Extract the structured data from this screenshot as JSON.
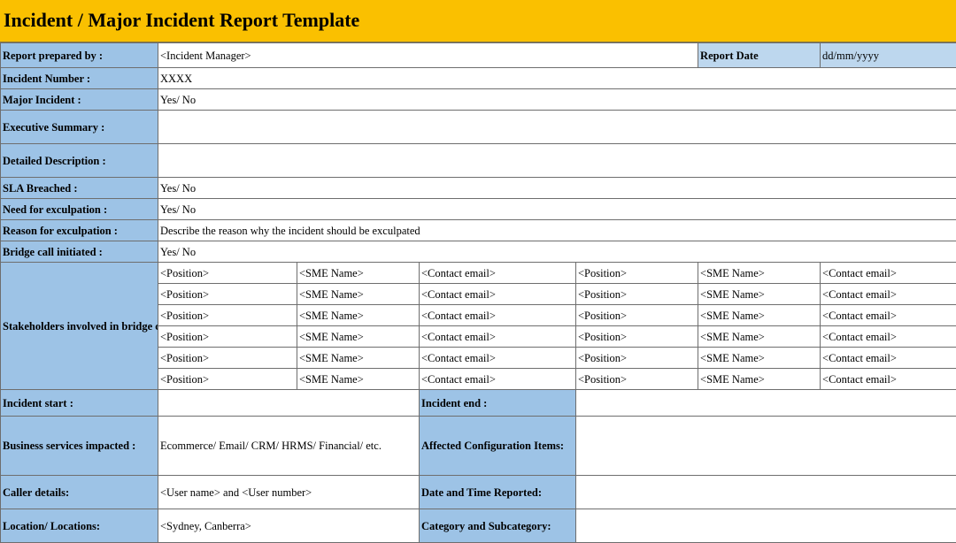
{
  "title": "Incident / Major Incident Report Template",
  "report": {
    "prepared_by_label": "Report prepared by :",
    "prepared_by_value": "<Incident Manager>",
    "date_label": "Report Date",
    "date_value": "dd/mm/yyyy"
  },
  "rows": {
    "incident_number": {
      "label": "Incident Number :",
      "value": "XXXX"
    },
    "major_incident": {
      "label": "Major Incident :",
      "value": "Yes/ No"
    },
    "executive_summary": {
      "label": "Executive Summary :",
      "value": ""
    },
    "detailed_description": {
      "label": "Detailed Description :",
      "value": ""
    },
    "sla_breached": {
      "label": "SLA Breached :",
      "value": "Yes/ No"
    },
    "need_exculpation": {
      "label": "Need for exculpation :",
      "value": "Yes/ No"
    },
    "reason_exculpation": {
      "label": "Reason for exculpation :",
      "value": "Describe the reason why the incident should be exculpated"
    },
    "bridge_call": {
      "label": "Bridge call initiated :",
      "value": "Yes/ No"
    }
  },
  "stakeholders": {
    "label": "Stakeholders involved in bridge call :",
    "rows": [
      [
        "<Position>",
        "<SME Name>",
        "<Contact email>",
        "<Position>",
        "<SME Name>",
        "<Contact email>"
      ],
      [
        "<Position>",
        "<SME Name>",
        "<Contact email>",
        "<Position>",
        "<SME Name>",
        "<Contact email>"
      ],
      [
        "<Position>",
        "<SME Name>",
        "<Contact email>",
        "<Position>",
        "<SME Name>",
        "<Contact email>"
      ],
      [
        "<Position>",
        "<SME Name>",
        "<Contact email>",
        "<Position>",
        "<SME Name>",
        "<Contact email>"
      ],
      [
        "<Position>",
        "<SME Name>",
        "<Contact email>",
        "<Position>",
        "<SME Name>",
        "<Contact email>"
      ],
      [
        "<Position>",
        "<SME Name>",
        "<Contact email>",
        "<Position>",
        "<SME Name>",
        "<Contact email>"
      ]
    ]
  },
  "pairs": [
    {
      "label_a": "Incident start :",
      "value_a": "",
      "label_b": "Incident end :",
      "value_b": ""
    },
    {
      "label_a": "Business services impacted :",
      "value_a": "Ecommerce/ Email/ CRM/ HRMS/ Financial/ etc.",
      "label_b": "Affected Configuration Items:",
      "value_b": ""
    },
    {
      "label_a": "Caller details:",
      "value_a": "<User name> and <User number>",
      "label_b": "Date and Time Reported:",
      "value_b": ""
    },
    {
      "label_a": "Location/ Locations:",
      "value_a": "<Sydney, Canberra>",
      "label_b": "Category and Subcategory:",
      "value_b": ""
    }
  ]
}
